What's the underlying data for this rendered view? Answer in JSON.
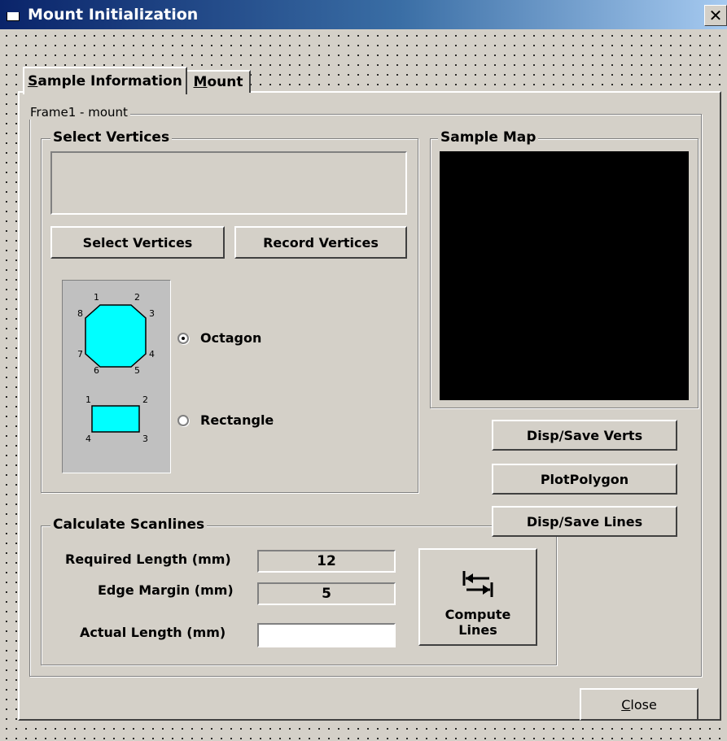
{
  "window": {
    "title": "Mount Initialization",
    "close_glyph": "✕"
  },
  "tabs": [
    {
      "label_u": "S",
      "label_rest": "ample Information",
      "active": true
    },
    {
      "label_u": "M",
      "label_rest": "ount",
      "active": false
    }
  ],
  "frame1": {
    "label": "Frame1 - mount"
  },
  "select_vertices": {
    "group_label": "Select Vertices",
    "text_value": "",
    "select_button": "Select Vertices",
    "record_button": "Record Vertices"
  },
  "shapes": {
    "octagon_numbers": [
      "1",
      "2",
      "3",
      "4",
      "5",
      "6",
      "7",
      "8"
    ],
    "rectangle_numbers": [
      "1",
      "2",
      "3",
      "4"
    ],
    "options": [
      {
        "label": "Octagon",
        "selected": true
      },
      {
        "label": "Rectangle",
        "selected": false
      }
    ],
    "fill_color": "#00ffff"
  },
  "sample_map": {
    "group_label": "Sample Map"
  },
  "buttons": {
    "disp_save_verts": "Disp/Save Verts",
    "plot_polygon": "PlotPolygon",
    "disp_save_lines": "Disp/Save Lines",
    "compute_line1": "Compute",
    "compute_line2": "Lines",
    "close_u": "C",
    "close_rest": "lose"
  },
  "scanlines": {
    "group_label": "Calculate Scanlines",
    "required_length_label": "Required Length (mm)",
    "required_length_value": "12",
    "edge_margin_label": "Edge Margin (mm)",
    "edge_margin_value": "5",
    "actual_length_label": "Actual Length (mm)",
    "actual_length_value": ""
  }
}
